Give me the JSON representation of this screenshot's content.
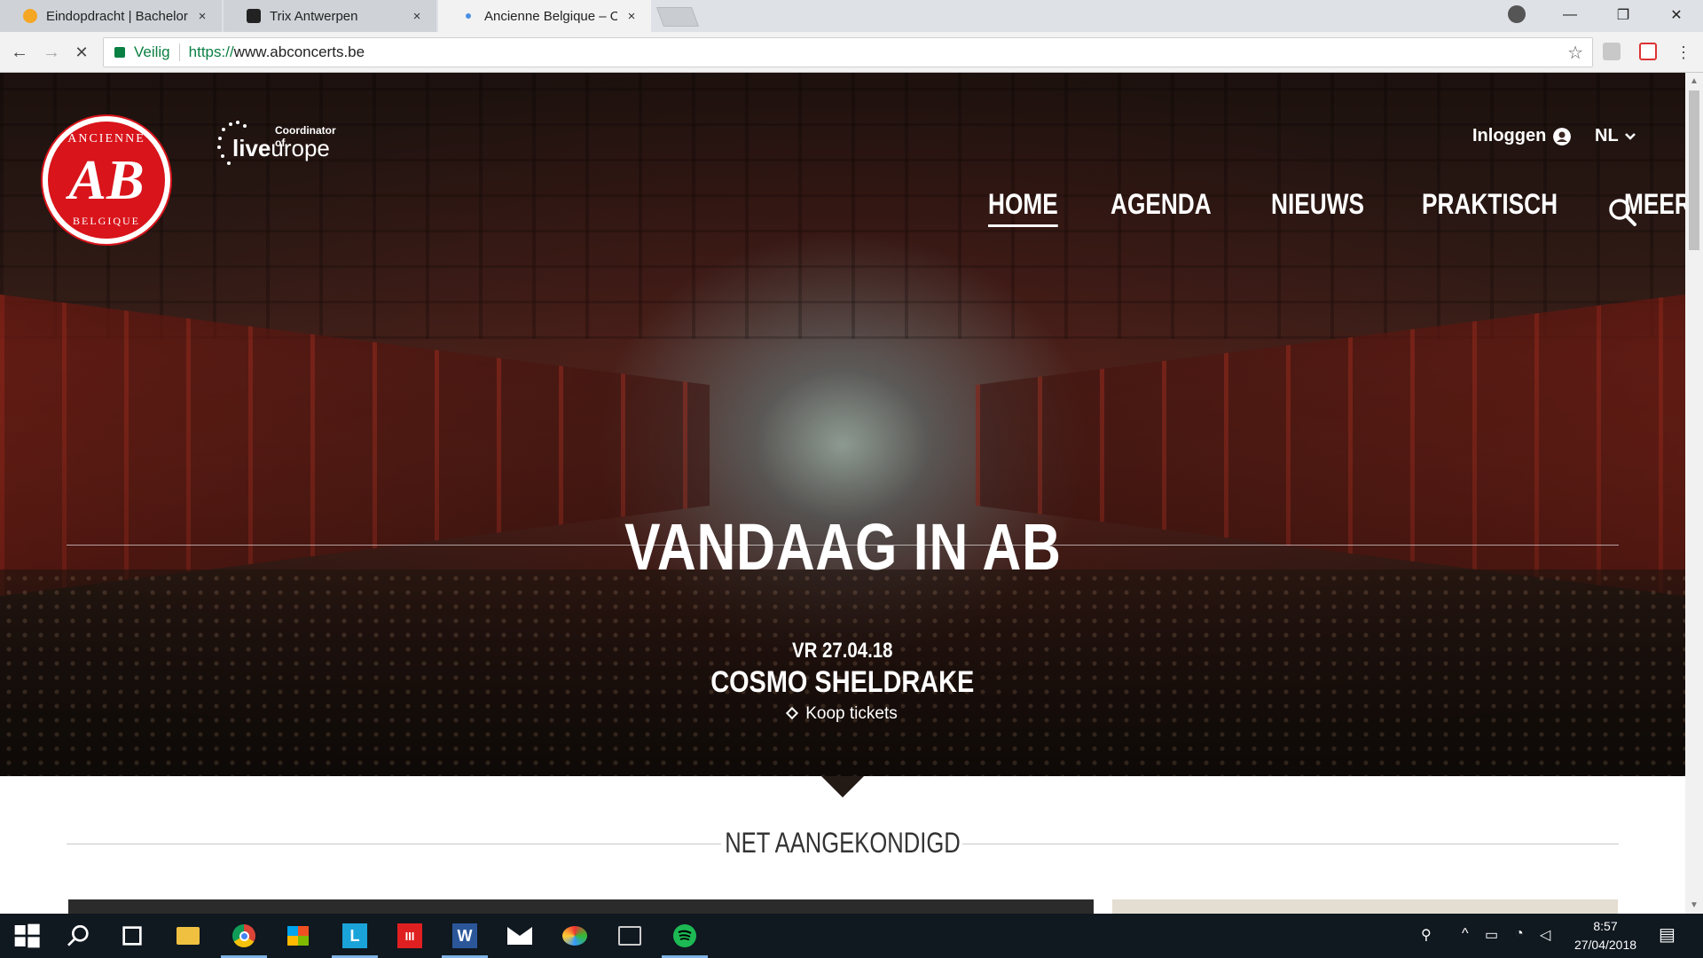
{
  "browser": {
    "tabs": [
      {
        "title": "Eindopdracht | Bachelor o",
        "close": "×",
        "favicon_color": "#f5a623"
      },
      {
        "title": "Trix Antwerpen",
        "close": "×",
        "favicon_color": "#222222"
      },
      {
        "title": "Ancienne Belgique – Offi",
        "close": "×",
        "favicon_color": "#d9141b"
      }
    ],
    "window_controls": {
      "minimize": "—",
      "restore": "❐",
      "close": "✕"
    },
    "nav": {
      "back": "←",
      "forward": "→",
      "stop": "✕"
    },
    "address": {
      "security_label": "Veilig",
      "url_scheme": "https://",
      "url_host": "www.abconcerts.be"
    },
    "bookmark_star": "☆"
  },
  "site": {
    "logo": {
      "text_top": "ANCIENNE",
      "monogram": "AB",
      "text_bottom": "BELGIQUE"
    },
    "liveurope": {
      "coordinator": "Coordinator of",
      "live": "live",
      "europe": "urope"
    },
    "login_label": "Inloggen",
    "language": "NL",
    "nav": [
      {
        "label": "HOME",
        "active": true
      },
      {
        "label": "AGENDA",
        "active": false
      },
      {
        "label": "NIEUWS",
        "active": false
      },
      {
        "label": "PRAKTISCH",
        "active": false
      },
      {
        "label": "MEER",
        "active": false
      }
    ],
    "hero": {
      "title": "VANDAAG IN AB",
      "date": "VR 27.04.18",
      "event": "COSMO SHELDRAKE",
      "tickets_label": "Koop tickets"
    },
    "section_title": "NET AANGEKONDIGD",
    "brand_color": "#d9141b"
  },
  "taskbar": {
    "clock_time": "8:57",
    "clock_date": "27/04/2018"
  }
}
